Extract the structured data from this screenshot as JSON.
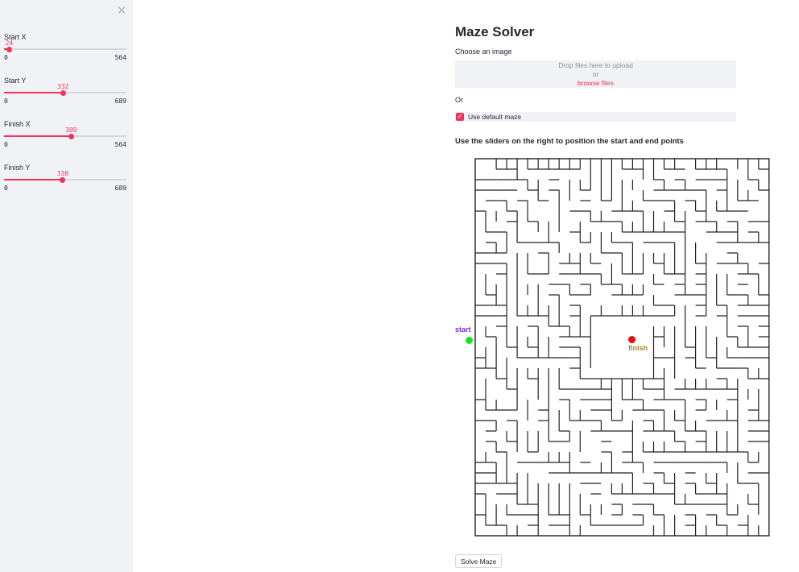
{
  "sidebar": {
    "close_icon": "close-icon",
    "sliders": [
      {
        "label": "Start X",
        "value": 24,
        "min": 0,
        "max": 564
      },
      {
        "label": "Start Y",
        "value": 332,
        "min": 0,
        "max": 689
      },
      {
        "label": "Finish X",
        "value": 309,
        "min": 0,
        "max": 564
      },
      {
        "label": "Finish Y",
        "value": 330,
        "min": 0,
        "max": 689
      }
    ]
  },
  "main": {
    "title": "Maze Solver",
    "uploader": {
      "label": "Choose an image",
      "drop_text": "Drop files here to upload",
      "or_text": "or",
      "browse_text": "browse files"
    },
    "or_label": "Or",
    "checkbox": {
      "label": "Use default maze",
      "checked": true
    },
    "instructions": "Use the sliders on the right to position the start and end points",
    "maze": {
      "start_label": "start",
      "finish_label": "finish",
      "start_color": "#1fe11f",
      "finish_color": "#e31212"
    },
    "solve_button": "Solve Maze"
  },
  "colors": {
    "accent": "#f0335a",
    "sidebar_bg": "#f0f2f6"
  }
}
